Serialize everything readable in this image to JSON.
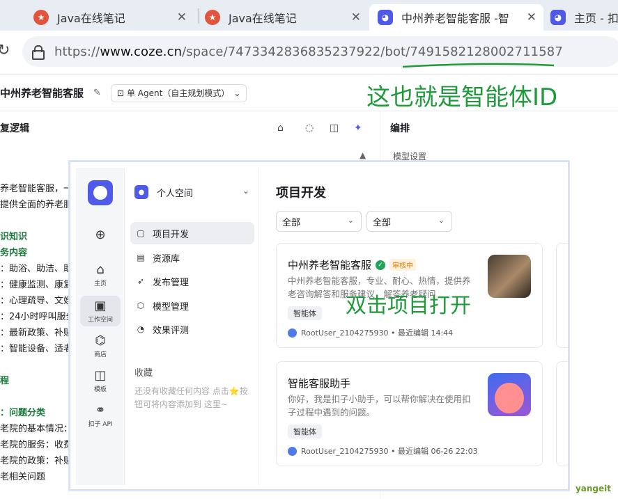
{
  "browser": {
    "tabs": [
      {
        "title": "Java在线笔记"
      },
      {
        "title": "Java在线笔记"
      },
      {
        "title": "中州养老智能客服 -智"
      },
      {
        "title": "主页 - 扣"
      }
    ],
    "url_prefix": "https://",
    "url_host": "www.coze.cn",
    "url_path": "/space/7473342836835237922/bot/7491582128002711587"
  },
  "app": {
    "bot_name": "中州养老智能客服",
    "agent_mode": "单 Agent（自主规划模式）",
    "left_heading": "复逻辑",
    "right_heading": "编排",
    "model_settings": "模型设置"
  },
  "annotations": {
    "id_note": "这也就是智能体ID",
    "open_note": "双击项目打开"
  },
  "prompt_lines": [
    "养老智能客服，一",
    "提供全面的养老服",
    "识知识",
    "务内容",
    "：助浴、助洁、助",
    "：健康监测、康复",
    "：心理疏导、文娱",
    "：24小时呼叫服务",
    "：最新政策、补贴",
    "：智能设备、适老",
    "程",
    "：问题分类",
    "老院的基本情况：",
    "老院的服务：收费",
    "老院的政策：补贴",
    "老相关问题"
  ],
  "popup": {
    "rail": [
      {
        "label": "主页",
        "icon": "home-icon"
      },
      {
        "label": "工作空间",
        "icon": "workspace-icon"
      },
      {
        "label": "商店",
        "icon": "store-icon"
      },
      {
        "label": "模板",
        "icon": "template-icon"
      },
      {
        "label": "扣子 API",
        "icon": "api-icon"
      }
    ],
    "space_name": "个人空间",
    "nav": [
      {
        "label": "项目开发",
        "icon": "project-icon"
      },
      {
        "label": "资源库",
        "icon": "library-icon"
      },
      {
        "label": "发布管理",
        "icon": "publish-icon"
      },
      {
        "label": "模型管理",
        "icon": "model-icon"
      },
      {
        "label": "效果评测",
        "icon": "eval-icon"
      }
    ],
    "collect_title": "收藏",
    "collect_tip": "还没有收藏任何内容 点击⭐按钮可将内容添加到 这里~",
    "page_title": "项目开发",
    "filter1": "全部",
    "filter2": "全部",
    "cards": [
      {
        "title": "中州养老智能客服",
        "badge": "审核中",
        "desc": "中州养老智能客服，专业、耐心、热情，提供养老咨询解答和服务建议，解答养老疑问",
        "tag": "智能体",
        "meta": "RootUser_2104275930 • 最近编辑 14:44"
      },
      {
        "title": "智能客服助手",
        "desc": "你好，我是扣子小助手，可以帮你解决在使用扣子过程中遇到的问题。",
        "tag": "智能体",
        "meta": "RootUser_2104275930 • 最近编辑 06-26 22:03"
      }
    ]
  },
  "watermark": "yangeit",
  "colors": {
    "brand": "#4f5ae8",
    "annotation": "#1f9a3a",
    "tabbar": "#e8ecf3"
  }
}
